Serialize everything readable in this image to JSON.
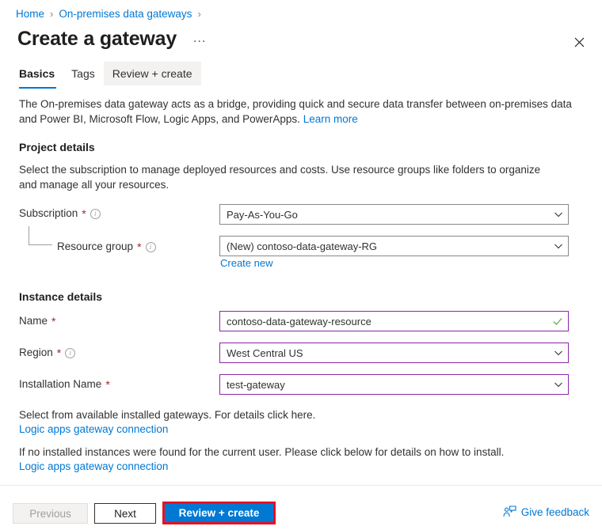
{
  "breadcrumb": {
    "items": [
      {
        "label": "Home",
        "icon": "none"
      },
      {
        "label": "On-premises data gateways",
        "icon": "none"
      }
    ],
    "separator": "›"
  },
  "header": {
    "title": "Create a gateway",
    "more_label": "…",
    "close_icon": "close-icon"
  },
  "tabs": [
    {
      "label": "Basics",
      "state": "active"
    },
    {
      "label": "Tags",
      "state": "default"
    },
    {
      "label": "Review + create",
      "state": "hovered"
    }
  ],
  "intro": {
    "text": "The On-premises data gateway acts as a bridge, providing quick and secure data transfer between on-premises data and Power BI, Microsoft Flow, Logic Apps, and PowerApps.",
    "link_label": "Learn more"
  },
  "project_details": {
    "heading": "Project details",
    "description": "Select the subscription to manage deployed resources and costs. Use resource groups like folders to organize and manage all your resources.",
    "subscription": {
      "label": "Subscription",
      "required_mark": "*",
      "info_glyph": "i",
      "value": "Pay-As-You-Go",
      "control": "dropdown"
    },
    "resource_group": {
      "label": "Resource group",
      "required_mark": "*",
      "info_glyph": "i",
      "value": "(New) contoso-data-gateway-RG",
      "control": "dropdown",
      "create_new_label": "Create new"
    }
  },
  "instance_details": {
    "heading": "Instance details",
    "name": {
      "label": "Name",
      "required_mark": "*",
      "value": "contoso-data-gateway-resource",
      "control": "textbox",
      "validation": "valid"
    },
    "region": {
      "label": "Region",
      "required_mark": "*",
      "info_glyph": "i",
      "value": "West Central US",
      "control": "dropdown"
    },
    "installation_name": {
      "label": "Installation Name",
      "required_mark": "*",
      "value": "test-gateway",
      "control": "dropdown"
    }
  },
  "notes": [
    {
      "text": "Select from available installed gateways. For details click here.",
      "link_label": "Logic apps gateway connection"
    },
    {
      "text": "If no installed instances were found for the current user. Please click below for details on how to install.",
      "link_label": "Logic apps gateway connection"
    }
  ],
  "footer": {
    "previous_label": "Previous",
    "next_label": "Next",
    "review_label": "Review + create",
    "feedback_label": "Give feedback"
  },
  "colors": {
    "accent_blue": "#0078d4",
    "link_blue": "#0078d4",
    "required_red": "#a4262c",
    "highlight_red": "#e81123",
    "field_purple": "#8c26a5",
    "valid_green": "#6aa84f",
    "border_gray": "#8a8886"
  }
}
